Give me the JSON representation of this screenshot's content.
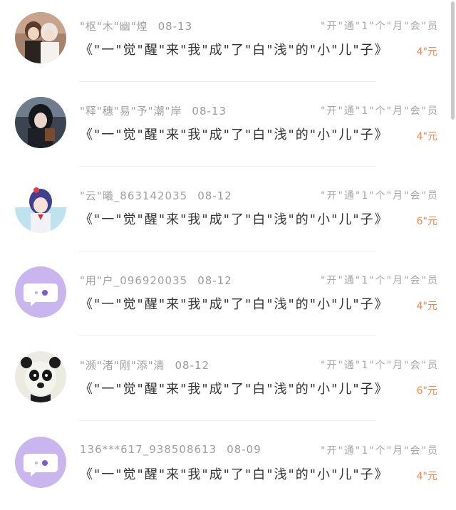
{
  "items": [
    {
      "name": "\"枢\"木\"幽\"煌",
      "date": "08-13",
      "title": "《\"一\"觉\"醒\"来\"我\"成\"了\"白\"浅\"的\"小\"儿\"子》",
      "status": "\"开\"通\"1\"个\"月\"会\"员",
      "price": "4\"元",
      "avatar": "anime-boy-avatar"
    },
    {
      "name": "\"释\"穗\"易\"予\"潮\"岸",
      "date": "08-13",
      "title": "《\"一\"觉\"醒\"来\"我\"成\"了\"白\"浅\"的\"小\"儿\"子》",
      "status": "\"开\"通\"1\"个\"月\"会\"员",
      "price": "4\"元",
      "avatar": "dark-hair-girl-avatar"
    },
    {
      "name": "\"云\"曦_863142035",
      "date": "08-12",
      "title": "《\"一\"觉\"醒\"来\"我\"成\"了\"白\"浅\"的\"小\"儿\"子》",
      "status": "\"开\"通\"1\"个\"月\"会\"员",
      "price": "6\"元",
      "avatar": "anime-girl-avatar"
    },
    {
      "name": "\"用\"户_096920035",
      "date": "08-12",
      "title": "《\"一\"觉\"醒\"来\"我\"成\"了\"白\"浅\"的\"小\"儿\"子》",
      "status": "\"开\"通\"1\"个\"月\"会\"员",
      "price": "4\"元",
      "avatar": "default-chat-avatar"
    },
    {
      "name": "\"濒\"渚\"刚\"添\"清",
      "date": "08-12",
      "title": "《\"一\"觉\"醒\"来\"我\"成\"了\"白\"浅\"的\"小\"儿\"子》",
      "status": "\"开\"通\"1\"个\"月\"会\"员",
      "price": "6\"元",
      "avatar": "panda-avatar"
    },
    {
      "name": "136***617_938508613",
      "date": "08-09",
      "title": "《\"一\"觉\"醒\"来\"我\"成\"了\"白\"浅\"的\"小\"儿\"子》",
      "status": "\"开\"通\"1\"个\"月\"会\"员",
      "price": "4\"元",
      "avatar": "default-chat-avatar"
    }
  ],
  "colors": {
    "price": "#f0884a",
    "default_avatar_bg": "#c9b6ee",
    "muted_text": "#a0a0a0"
  }
}
